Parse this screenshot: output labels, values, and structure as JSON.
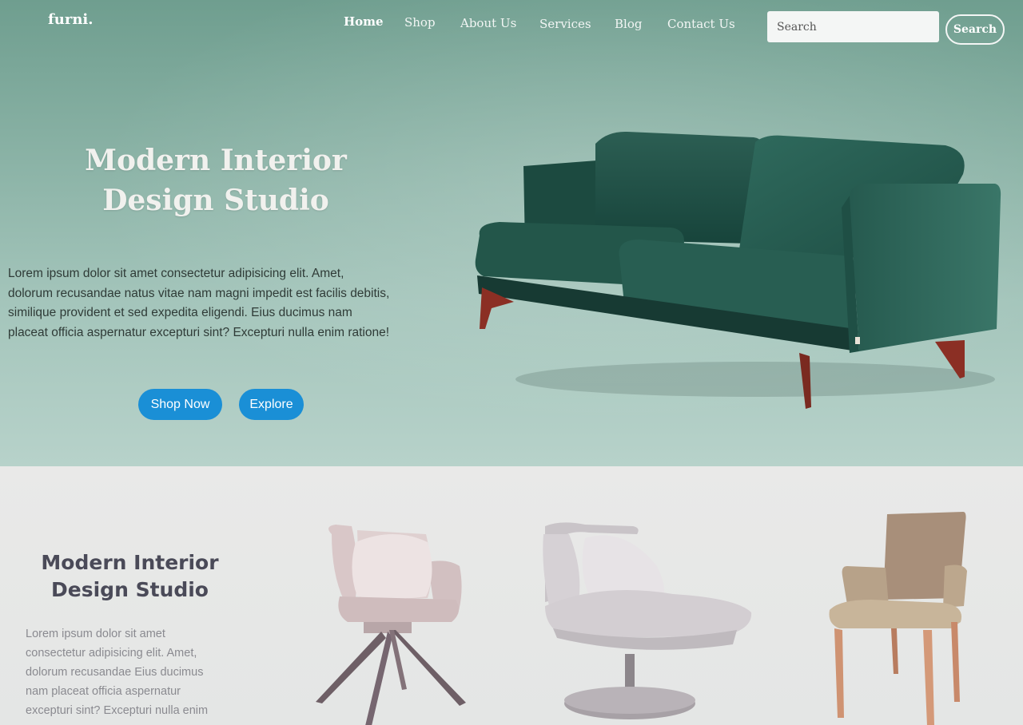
{
  "brand": {
    "logo": "furni."
  },
  "nav": {
    "items": [
      {
        "label": "Home",
        "active": true
      },
      {
        "label": "Shop",
        "active": false
      },
      {
        "label": "About Us",
        "active": false
      },
      {
        "label": "Services",
        "active": false
      },
      {
        "label": "Blog",
        "active": false
      },
      {
        "label": "Contact Us",
        "active": false
      }
    ]
  },
  "search": {
    "placeholder": "Search",
    "button_label": "Search"
  },
  "hero": {
    "title_line1": "Modern Interior",
    "title_line2": "Design Studio",
    "text_line1": "Lorem ipsum dolor sit amet consectetur adipisicing elit. Amet,",
    "text_line2": "dolorum recusandae natus vitae nam magni impedit est facilis debitis,",
    "text_line3": "similique provident et sed expedita eligendi. Eius ducimus nam",
    "text_line4": "placeat officia aspernatur excepturi sint? Excepturi nulla enim ratione!",
    "shop_now_label": "Shop Now",
    "explore_label": "Explore",
    "button_color": "#1a8fd6",
    "product_image": "green-velvet-sofa"
  },
  "section2": {
    "title_line1": "Modern Interior",
    "title_line2": "Design Studio",
    "text_line1": "Lorem ipsum dolor sit amet",
    "text_line2": "consectetur adipisicing elit. Amet,",
    "text_line3": "dolorum recusandae Eius ducimus",
    "text_line4": "nam placeat officia aspernatur",
    "text_line5": "excepturi sint? Excepturi nulla enim",
    "products": [
      "pink-armchair-with-pillow",
      "white-lounge-chair",
      "beige-armchair"
    ]
  }
}
